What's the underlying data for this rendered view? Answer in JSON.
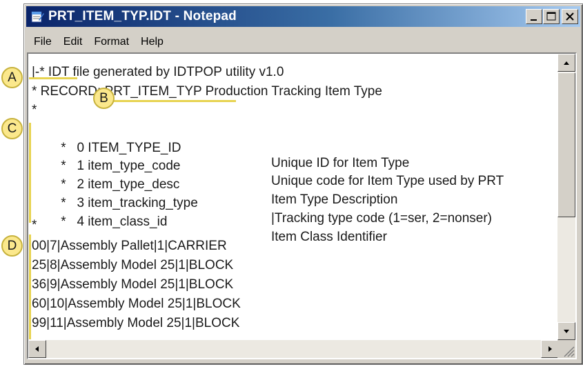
{
  "window": {
    "title": "PRT_ITEM_TYP.IDT - Notepad"
  },
  "menu": [
    "File",
    "Edit",
    "Format",
    "Help"
  ],
  "content": {
    "header_lines": [
      "|-* IDT file generated by IDTPOP utility v1.0",
      "* RECORD: PRT_ITEM_TYP Production Tracking Item Type",
      "*"
    ],
    "field_rows": [
      {
        "index": "*   0 ITEM_TYPE_ID",
        "description": "Unique ID for Item Type"
      },
      {
        "index": "*   1 item_type_code",
        "description": "Unique code for Item Type used by PRT"
      },
      {
        "index": "*   2 item_type_desc",
        "description": "Item Type Description"
      },
      {
        "index": "*   3 item_tracking_type",
        "description": "|Tracking type code (1=ser, 2=nonser)"
      },
      {
        "index": "*   4 item_class_id",
        "description": "Item Class Identifier"
      }
    ],
    "separator": "*",
    "data_rows": [
      "00|7|Assembly Pallet|1|CARRIER",
      "25|8|Assembly Model 25|1|BLOCK",
      "36|9|Assembly Model 25|1|BLOCK",
      "60|10|Assembly Model 25|1|BLOCK",
      "99|11|Assembly Model 25|1|BLOCK"
    ]
  },
  "callouts": {
    "a": "A",
    "b": "B",
    "c": "C",
    "d": "D"
  },
  "colors": {
    "titlebar_start": "#0a246a",
    "titlebar_end": "#a6caf0",
    "callout_fill": "#fbe88c",
    "callout_line": "#e7d34f"
  }
}
